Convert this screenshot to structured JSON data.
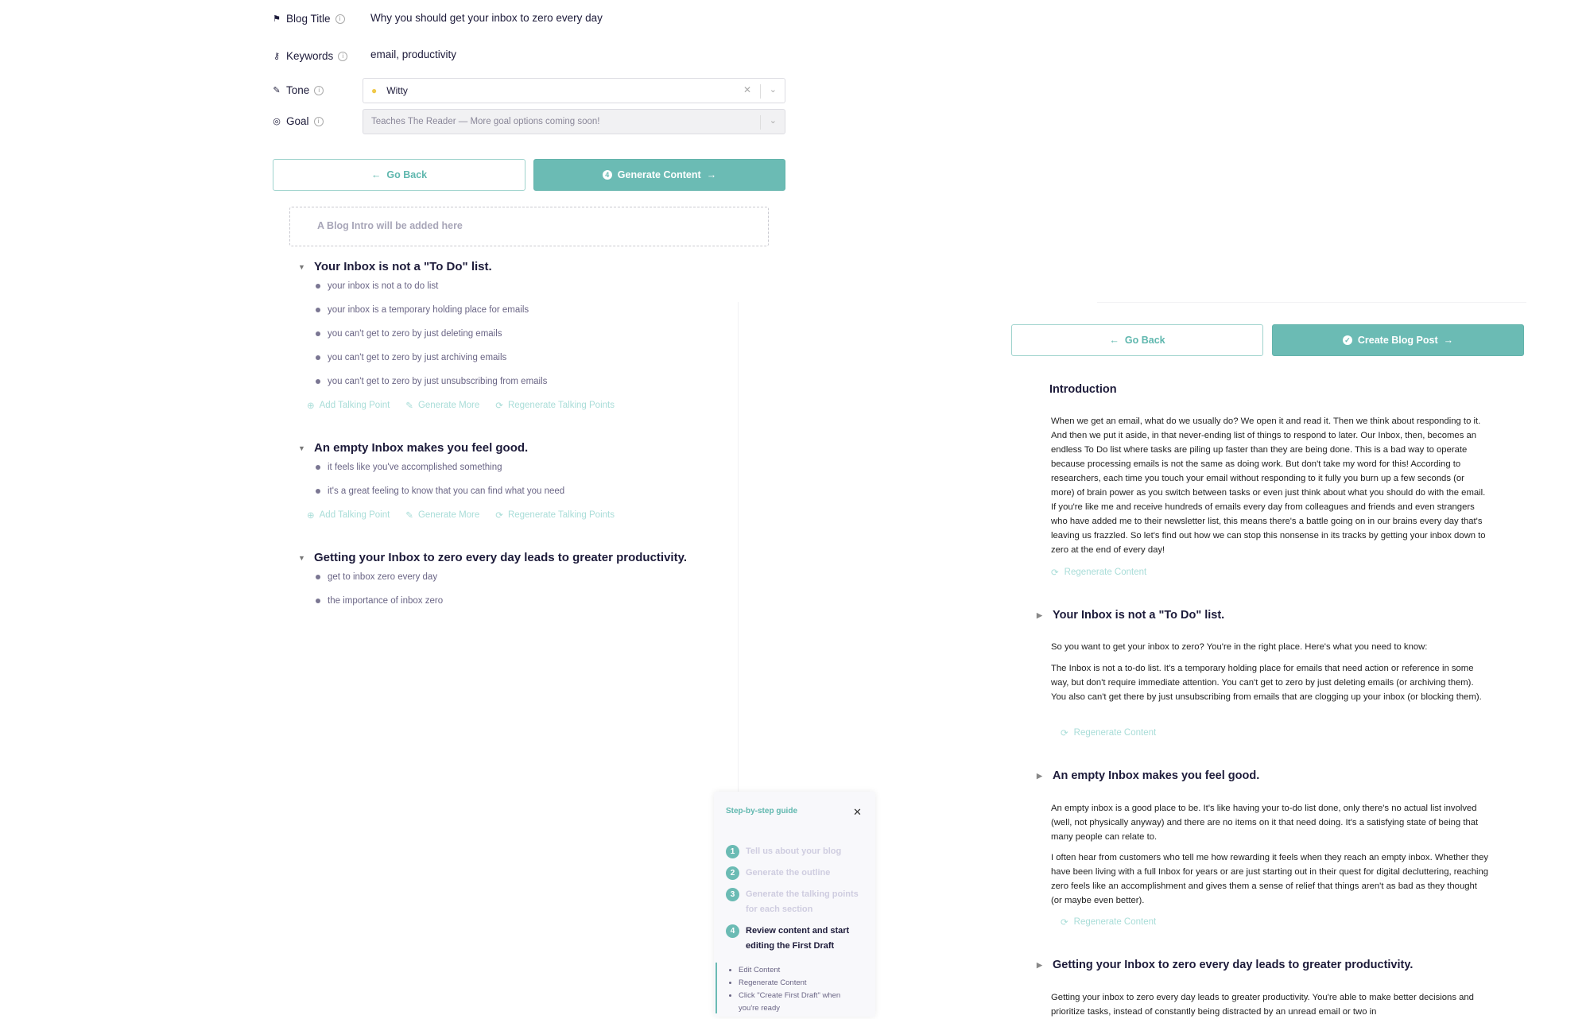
{
  "form": {
    "blog_title_label": "Blog Title",
    "blog_title_value": "Why you should get your inbox to zero every day",
    "keywords_label": "Keywords",
    "keywords_value": "email, productivity",
    "tone_label": "Tone",
    "tone_value": "Witty",
    "goal_label": "Goal",
    "goal_value": "Teaches The Reader — More goal options coming soon!"
  },
  "left_buttons": {
    "back": "Go Back",
    "generate": "Generate Content"
  },
  "intro_placeholder": "A Blog Intro will be added here",
  "outline": [
    {
      "heading": "Your Inbox is not a \"To Do\" list.",
      "points": [
        "your inbox is not a to do list",
        "your inbox is a temporary holding place for emails",
        "you can't get to zero by just deleting emails",
        "you can't get to zero by just archiving emails",
        "you can't get to zero by just unsubscribing from emails"
      ]
    },
    {
      "heading": "An empty Inbox makes you feel good.",
      "points": [
        "it feels like you've accomplished something",
        "it's a great feeling to know that you can find what you need"
      ]
    },
    {
      "heading": "Getting your Inbox to zero every day leads to greater productivity.",
      "points": [
        "get to inbox zero every day",
        "the importance of inbox zero"
      ]
    }
  ],
  "outline_actions": {
    "add": "Add Talking Point",
    "more": "Generate More",
    "regen": "Regenerate Talking Points"
  },
  "guide": {
    "title": "Step-by-step guide",
    "steps": [
      {
        "n": "1",
        "text": "Tell us about your blog"
      },
      {
        "n": "2",
        "text": "Generate the outline"
      },
      {
        "n": "3",
        "text": "Generate the talking points for each section"
      },
      {
        "n": "4",
        "text": "Review content and start editing the First Draft"
      }
    ],
    "substeps": [
      "Edit Content",
      "Regenerate Content",
      "Click \"Create First Draft\" when you're ready"
    ]
  },
  "right_buttons": {
    "back": "Go Back",
    "create": "Create Blog Post"
  },
  "content": {
    "regen_label": "Regenerate Content",
    "intro_heading": "Introduction",
    "intro": "When we get an email, what do we usually do? We open it and read it. Then we think about responding to it. And then we put it aside, in that never-ending list of things to respond to later. Our Inbox, then, becomes an endless To Do list where tasks are piling up faster than they are being done. This is a bad way to operate because processing emails is not the same as doing work. But don't take my word for this! According to researchers, each time you touch your email without responding to it fully you burn up a few seconds (or more) of brain power as you switch between tasks or even just think about what you should do with the email. If you're like me and receive hundreds of emails every day from colleagues and friends and even strangers who have added me to their newsletter list, this means there's a battle going on in our brains every day that's leaving us frazzled. So let's find out how we can stop this nonsense in its tracks by getting your inbox down to zero at the end of every day!",
    "sections": [
      {
        "heading": "Your Inbox is not a \"To Do\" list.",
        "paras": [
          "So you want to get your inbox to zero? You're in the right place. Here's what you need to know:",
          "The Inbox is not a to-do list. It's a temporary holding place for emails that need action or reference in some way, but don't require immediate attention. You can't get to zero by just deleting emails (or archiving them). You also can't get there by just unsubscribing from emails that are clogging up your inbox (or blocking them)."
        ]
      },
      {
        "heading": "An empty Inbox makes you feel good.",
        "paras": [
          "An empty inbox is a good place to be. It's like having your to-do list done, only there's no actual list involved (well, not physically anyway) and there are no items on it that need doing. It's a satisfying state of being that many people can relate to.",
          "I often hear from customers who tell me how rewarding it feels when they reach an empty inbox. Whether they have been living with a full Inbox for years or are just starting out in their quest for digital decluttering, reaching zero feels like an accomplishment and gives them a sense of relief that things aren't as bad as they thought (or maybe even better)."
        ]
      },
      {
        "heading": "Getting your Inbox to zero every day leads to greater productivity.",
        "paras": [
          "Getting your inbox to zero every day leads to greater productivity. You're able to make better decisions and prioritize tasks, instead of constantly being distracted by an unread email or two in"
        ]
      }
    ]
  },
  "colors": {
    "accent": "#6bbbb4",
    "heading": "#1d1b3a",
    "muted": "#6a6585"
  }
}
